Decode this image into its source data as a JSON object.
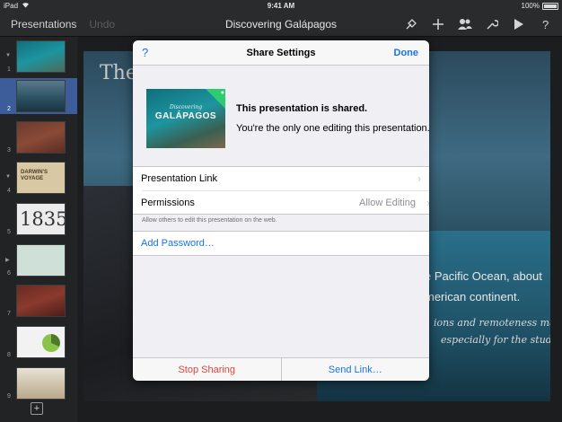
{
  "status_bar": {
    "device": "iPad",
    "time": "9:41 AM",
    "battery": "100%"
  },
  "toolbar": {
    "back_label": "Presentations",
    "undo_label": "Undo",
    "title": "Discovering Galápagos",
    "icons": [
      "format-brush-icon",
      "plus-icon",
      "collaborate-icon",
      "wrench-icon",
      "play-icon",
      "help-icon"
    ]
  },
  "navigator": {
    "slides": [
      {
        "number": "1"
      },
      {
        "number": "2"
      },
      {
        "number": "3"
      },
      {
        "number": "4",
        "text": "DARWIN'S VOYAGE"
      },
      {
        "number": "5",
        "text": "1835"
      },
      {
        "number": "6"
      },
      {
        "number": "7"
      },
      {
        "number": "8"
      },
      {
        "number": "9"
      }
    ],
    "selected_slide": 2
  },
  "slide": {
    "title_partial": "The",
    "body_line_1": "e Pacific Ocean, about",
    "body_line_2": "merican continent.",
    "italic_line_1": "ions and remoteness make",
    "italic_line_2": "especially for the study"
  },
  "share_settings": {
    "help_label": "?",
    "title": "Share Settings",
    "done_label": "Done",
    "thumbnail": {
      "subtitle": "Discovering",
      "title": "GALÁPAGOS"
    },
    "status": "This presentation is shared.",
    "sub_status": "You're the only one editing this presentation.",
    "presentation_link_label": "Presentation Link",
    "permissions_label": "Permissions",
    "permissions_value": "Allow Editing",
    "permissions_footnote": "Allow others to edit this presentation on the web.",
    "add_password_label": "Add Password…",
    "stop_sharing_label": "Stop Sharing",
    "send_link_label": "Send Link…"
  },
  "colors": {
    "accent": "#1a73e8",
    "destructive": "#e0443a",
    "shared_badge": "#2ecc71"
  }
}
